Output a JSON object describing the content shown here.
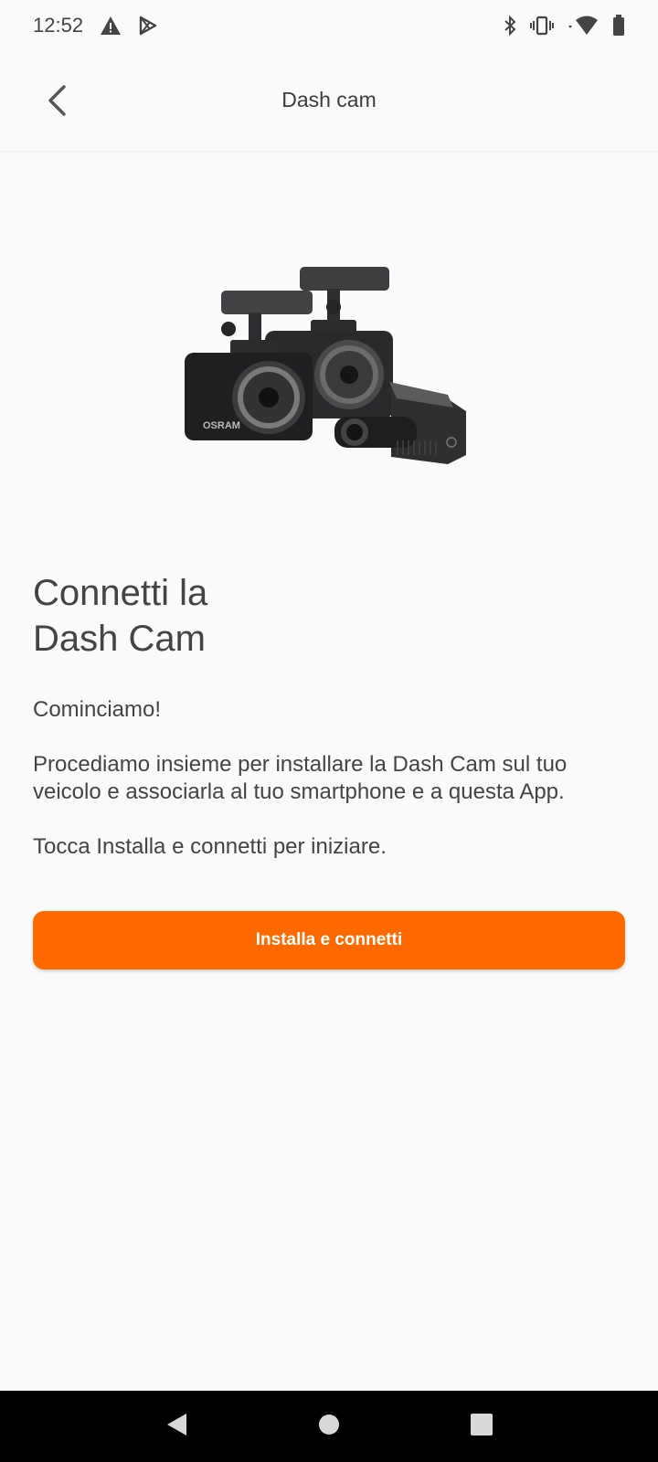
{
  "status_bar": {
    "time": "12:52",
    "left_icons": [
      "warning-icon",
      "play-store-icon"
    ],
    "right_icons": [
      "bluetooth-icon",
      "vibrate-icon",
      "wifi-icon",
      "battery-icon"
    ]
  },
  "app_bar": {
    "title": "Dash cam",
    "back_icon": "chevron-left-icon"
  },
  "hero": {
    "image": "dash-cams-image",
    "brand_text": "OSRAM"
  },
  "content": {
    "heading_line1": "Connetti la",
    "heading_line2": "Dash Cam",
    "intro": "Cominciamo!",
    "description": "Procediamo insieme per installare la Dash Cam sul tuo veicolo e associarla al tuo smartphone e a questa App.",
    "instruction": "Tocca Installa e connetti per iniziare."
  },
  "actions": {
    "primary_label": "Installa e connetti"
  },
  "colors": {
    "accent": "#ff6a00",
    "background": "#fafafa",
    "text": "#444444",
    "nav_bar": "#000000"
  },
  "nav_bar": {
    "icons": [
      "nav-back-icon",
      "nav-home-icon",
      "nav-recents-icon"
    ]
  }
}
